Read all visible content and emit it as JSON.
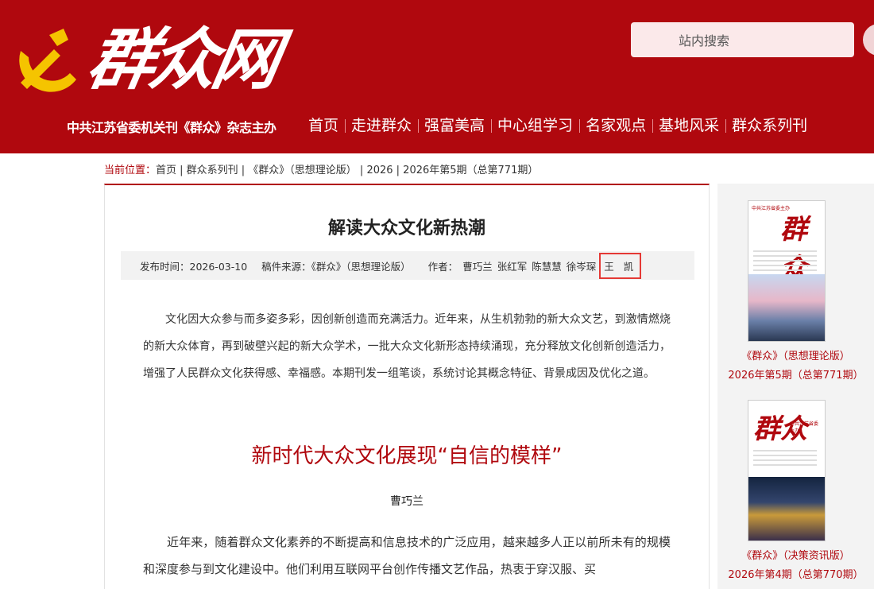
{
  "header": {
    "logo": "群众网",
    "sponsor": "中共江苏省委机关刊《群众》杂志主办",
    "search_placeholder": "站内搜索",
    "nav": [
      "首页",
      "走进群众",
      "强富美高",
      "中心组学习",
      "名家观点",
      "基地风采",
      "群众系列刊"
    ]
  },
  "breadcrumb": {
    "lead": "当前位置：",
    "path": "首页 | 群众系列刊 | 《群众》（思想理论版） | 2026 | 2026年第5期（总第771期）"
  },
  "article": {
    "title": "解读大众文化新热潮",
    "publish_time": "发布时间：2026-03-10",
    "source": "稿件来源：《群众》（思想理论版）",
    "authors_label": "作者：",
    "authors": [
      "曹巧兰",
      "张红军",
      "陈慧慧",
      "徐岑琛"
    ],
    "highlighted_author": "王 凯",
    "intro": "文化因大众参与而多姿多彩，因创新创造而充满活力。近年来，从生机勃勃的新大众文艺，到激情燃烧的新大众体育，再到破壁兴起的新大众学术，一批大众文化新形态持续涌现，充分释放文化创新创造活力，增强了人民群众文化获得感、幸福感。本期刊发一组笔谈，系统讨论其概念特征、背景成因及优化之道。",
    "subtitle": "新时代大众文化展现“自信的模样”",
    "byline": "曹巧兰",
    "body": "近年来，随着群众文化素养的不断提高和信息技术的广泛应用，越来越多人正以前所未有的规模和深度参与到文化建设中。他们利用互联网平台创作传播文艺作品，热衷于穿汉服、买"
  },
  "sidebar": {
    "covers": [
      {
        "brand": "群众",
        "top": "中共江苏省委主办",
        "caption_line1": "《群众》（思想理论版）",
        "caption_line2": "2026年第5期（总第771期）"
      },
      {
        "brand": "群众",
        "top": "中共江苏省委主办",
        "caption_line1": "《群众》（决策资讯版）",
        "caption_line2": "2026年第4期（总第770期）"
      }
    ]
  }
}
